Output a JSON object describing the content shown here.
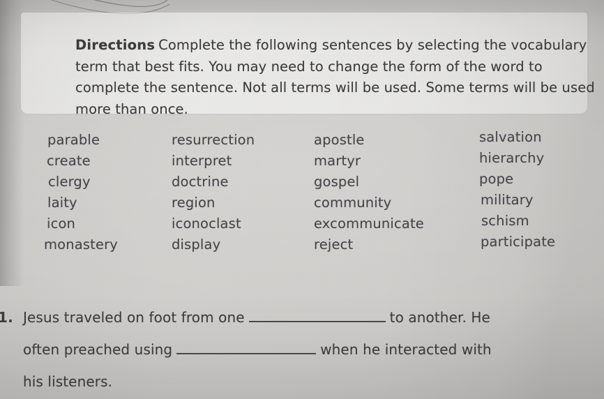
{
  "document": {
    "type": "vocabulary-worksheet-scan",
    "paper_color": "#cbcac7",
    "ink_color": "#3b3b3d"
  },
  "directions": {
    "lead_label": "Directions",
    "body": "Complete the following sentences by selecting the vocabulary term that best fits. You may need to change the form of the word to complete the sentence. Not all terms will be used. Some terms will be used more than once."
  },
  "word_bank": {
    "columns": [
      {
        "words": [
          "parable",
          "create",
          "clergy",
          "laity",
          "icon",
          "monastery"
        ]
      },
      {
        "words": [
          "resurrection",
          "interpret",
          "doctrine",
          "region",
          "iconoclast",
          "display"
        ]
      },
      {
        "words": [
          "apostle",
          "martyr",
          "gospel",
          "community",
          "excommunicate",
          "reject"
        ]
      },
      {
        "words": [
          "salvation",
          "hierarchy",
          "pope",
          "military",
          "schism",
          "participate"
        ]
      }
    ]
  },
  "questions": [
    {
      "number": "1.",
      "segments": {
        "part1": "Jesus traveled on foot from one",
        "part2": "to another. He",
        "part3": "often preached using",
        "part4": "when he interacted with",
        "part5": "his listeners."
      },
      "blanks": [
        {
          "answer": ""
        },
        {
          "answer": ""
        }
      ]
    }
  ],
  "annotations": {
    "pen_mark": "curved-pen-arc-top-left"
  }
}
